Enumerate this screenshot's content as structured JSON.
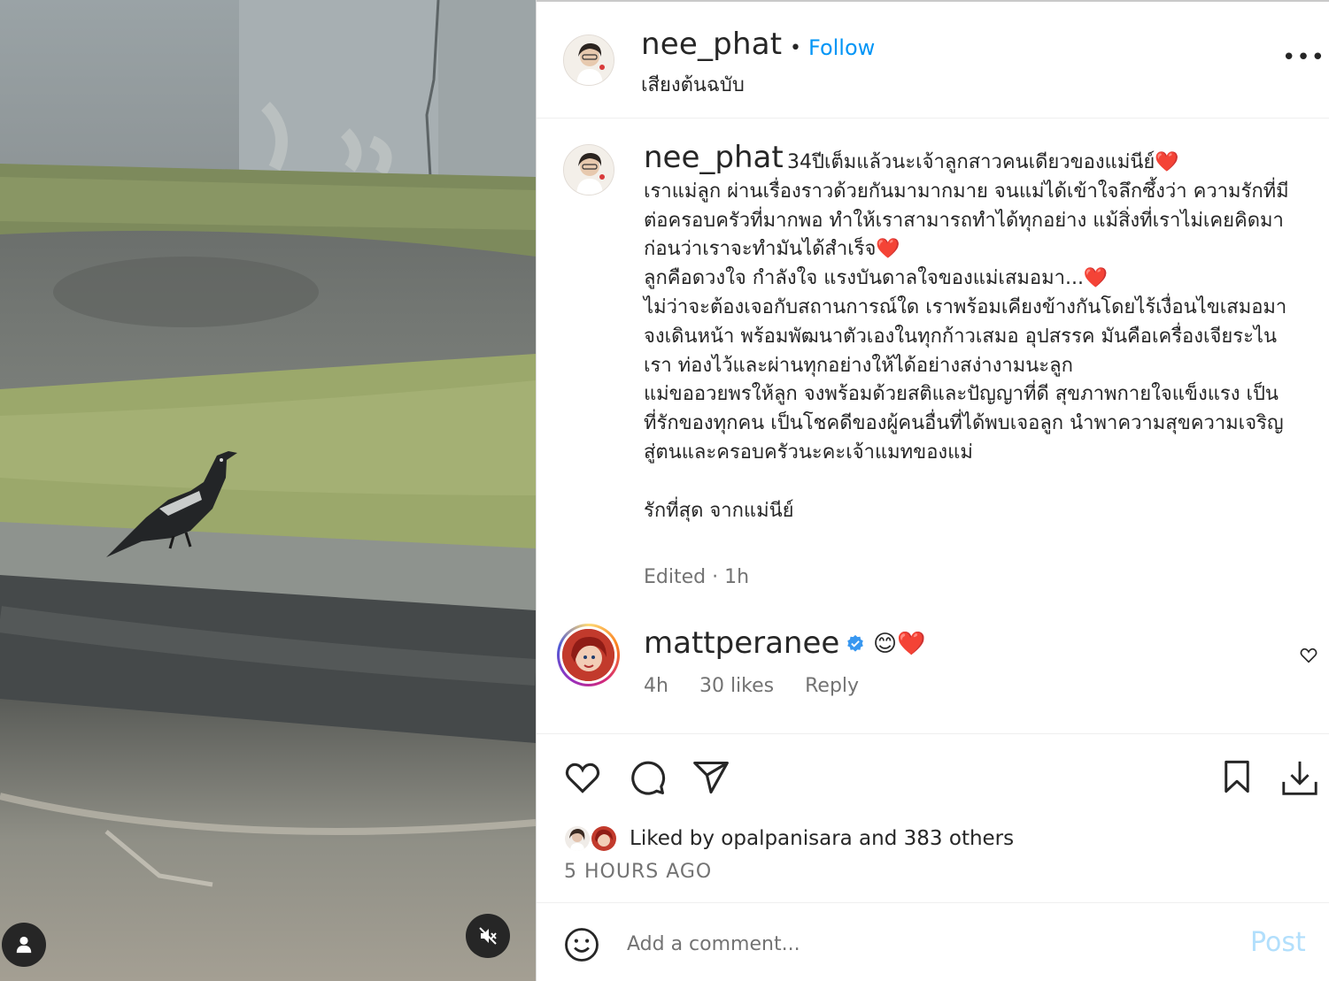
{
  "colors": {
    "link": "#0095f6",
    "muted": "#737373",
    "text": "#262626",
    "post_disabled": "#b2dffc",
    "heart": "#e0245e"
  },
  "media": {
    "description_icons": [
      "user-tag-icon",
      "mute-icon"
    ]
  },
  "header": {
    "username": "nee_phat",
    "separator": "•",
    "follow": "Follow",
    "audio": "เสียงต้นฉบับ",
    "more": "•••"
  },
  "caption": {
    "username": "nee_phat",
    "text": "34ปีเต็มแล้วนะเจ้าลูกสาวคนเดียวของแม่นีย์❤️\nเราแม่ลูก ผ่านเรื่องราวด้วยกันมามากมาย จนแม่ได้เข้าใจลึกซึ้งว่า ความรักที่มีต่อครอบครัวที่มากพอ ทำให้เราสามารถทำได้ทุกอย่าง แม้สิ่งที่เราไม่เคยคิดมาก่อนว่าเราจะทำมันได้สำเร็จ❤️\nลูกคือดวงใจ กำลังใจ แรงบันดาลใจของแม่เสมอมา...❤️\nไม่ว่าจะต้องเจอกับสถานการณ์ใด เราพร้อมเคียงข้างกันโดยไร้เงื่อนไขเสมอมา\nจงเดินหน้า พร้อมพัฒนาตัวเองในทุกก้าวเสมอ อุปสรรค มันคือเครื่องเจียระไนเรา ท่องไว้และผ่านทุกอย่างให้ได้อย่างสง่างามนะลูก\nแม่ขออวยพรให้ลูก จงพร้อมด้วยสติและปัญญาที่ดี สุขภาพกายใจแข็งแรง เป็นที่รักของทุกคน เป็นโชคดีของผู้คนอื่นที่ได้พบเจอลูก นำพาความสุขความเจริญสู่ตนและครอบครัวนะคะเจ้าแมทของแม่\n\nรักที่สุด จากแม่นีย์",
    "edited": "Edited · 1h"
  },
  "comment": {
    "username": "mattperanee",
    "text": "😊❤️",
    "time": "4h",
    "likes": "30 likes",
    "reply": "Reply"
  },
  "liked": {
    "prefix": "Liked by ",
    "user": "opalpanisara",
    "middle": " and ",
    "others": "383 others"
  },
  "time": "5 HOURS AGO",
  "add_comment": {
    "placeholder": "Add a comment...",
    "post": "Post"
  }
}
